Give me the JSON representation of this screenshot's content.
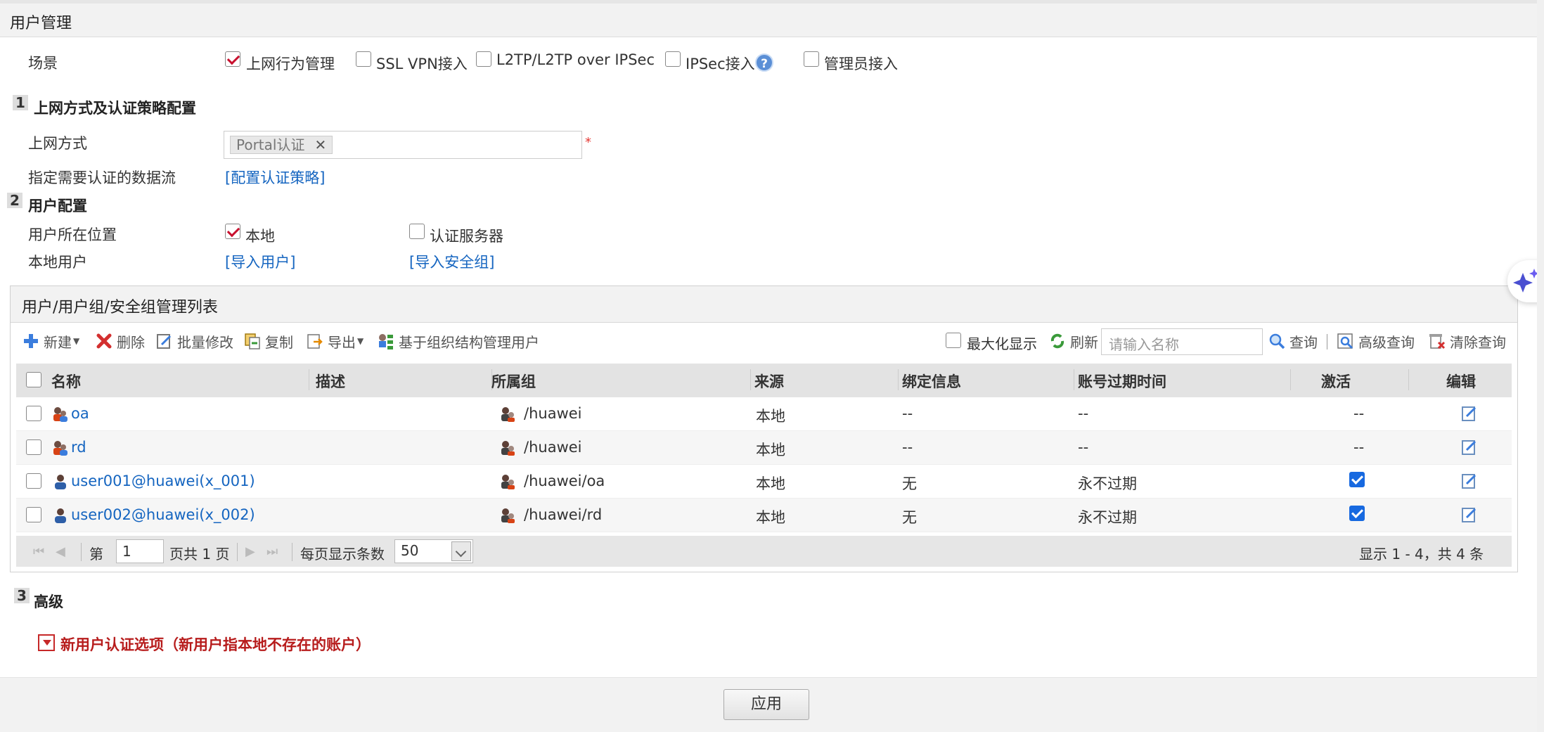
{
  "page": {
    "title": "用户管理"
  },
  "scene": {
    "label": "场景",
    "options": [
      {
        "label": "上网行为管理",
        "checked": true
      },
      {
        "label": "SSL VPN接入",
        "checked": false
      },
      {
        "label": "L2TP/L2TP over IPSec",
        "checked": false
      },
      {
        "label": "IPSec接入",
        "checked": false
      },
      {
        "label": "管理员接入",
        "checked": false
      }
    ],
    "help_glyph": "?"
  },
  "section1": {
    "num": "1",
    "title": "上网方式及认证策略配置",
    "access_label": "上网方式",
    "access_tag": "Portal认证",
    "tag_close": "✕",
    "required_mark": "*",
    "flow_label": "指定需要认证的数据流",
    "flow_link": "[配置认证策略]"
  },
  "section2": {
    "num": "2",
    "title": "用户配置",
    "location_label": "用户所在位置",
    "location_local": "本地",
    "location_server": "认证服务器",
    "local_user_label": "本地用户",
    "import_user": "[导入用户]",
    "import_group": "[导入安全组]"
  },
  "list": {
    "title": "用户/用户组/安全组管理列表",
    "toolbar": {
      "new": "新建",
      "delete": "删除",
      "batch_edit": "批量修改",
      "copy": "复制",
      "export": "导出",
      "org_manage": "基于组织结构管理用户",
      "maximize": "最大化显示",
      "refresh": "刷新",
      "search_placeholder": "请输入名称",
      "query": "查询",
      "adv_query": "高级查询",
      "clear_query": "清除查询"
    },
    "columns": [
      "名称",
      "描述",
      "所属组",
      "来源",
      "绑定信息",
      "账号过期时间",
      "激活",
      "编辑"
    ],
    "rows": [
      {
        "name": "oa",
        "desc": "",
        "group": "/huawei",
        "source": "本地",
        "bind": "--",
        "expire": "--",
        "active": "--"
      },
      {
        "name": "rd",
        "desc": "",
        "group": "/huawei",
        "source": "本地",
        "bind": "--",
        "expire": "--",
        "active": "--"
      },
      {
        "name": "user001@huawei(x_001)",
        "desc": "",
        "group": "/huawei/oa",
        "source": "本地",
        "bind": "无",
        "expire": "永不过期",
        "active": true
      },
      {
        "name": "user002@huawei(x_002)",
        "desc": "",
        "group": "/huawei/rd",
        "source": "本地",
        "bind": "无",
        "expire": "永不过期",
        "active": true
      }
    ],
    "pager": {
      "page_prefix": "第",
      "page_value": "1",
      "page_suffix": "页共 1 页",
      "per_page_label": "每页显示条数",
      "per_page_value": "50",
      "summary": "显示 1 - 4，共 4 条"
    }
  },
  "section3": {
    "num": "3",
    "title": "高级",
    "option": "新用户认证选项（新用户指本地不存在的账户）"
  },
  "footer": {
    "apply": "应用"
  },
  "colors": {
    "link": "#1565c0",
    "check_red": "#c8102e",
    "active_blue": "#1769e0",
    "advanced_red": "#b71c1c"
  }
}
